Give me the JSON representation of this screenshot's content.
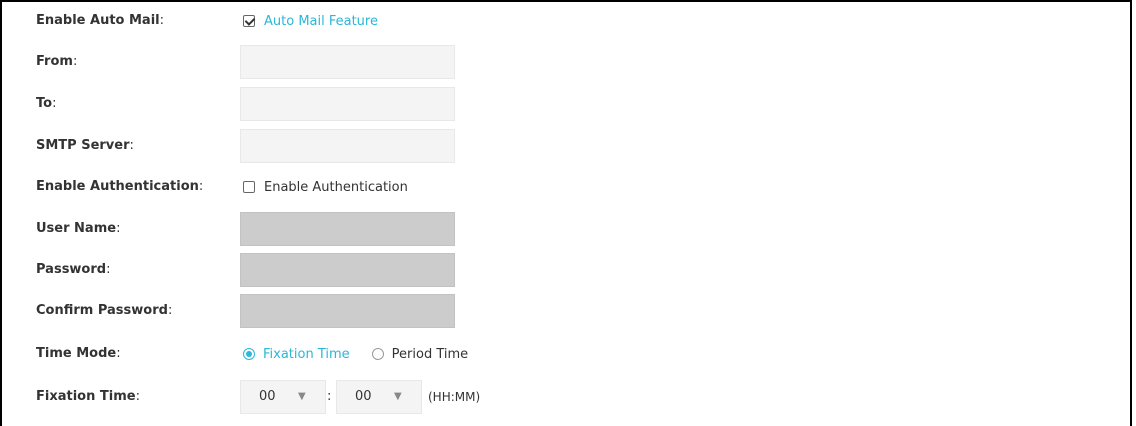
{
  "form": {
    "enable_auto_mail": {
      "label": "Enable Auto Mail",
      "colon": ":",
      "checkbox_label": "Auto Mail Feature",
      "checked": true
    },
    "from": {
      "label": "From",
      "colon": ":",
      "value": ""
    },
    "to": {
      "label": "To",
      "colon": ":",
      "value": ""
    },
    "smtp_server": {
      "label": "SMTP Server",
      "colon": ":",
      "value": ""
    },
    "enable_authentication": {
      "label": "Enable Authentication",
      "colon": ":",
      "checkbox_label": "Enable Authentication",
      "checked": false
    },
    "user_name": {
      "label": "User Name",
      "colon": ":",
      "value": ""
    },
    "password": {
      "label": "Password",
      "colon": ":",
      "value": ""
    },
    "confirm_password": {
      "label": "Confirm Password",
      "colon": ":",
      "value": ""
    },
    "time_mode": {
      "label": "Time Mode",
      "colon": ":",
      "options": [
        "Fixation Time",
        "Period Time"
      ],
      "selected": "Fixation Time"
    },
    "fixation_time": {
      "label": "Fixation Time",
      "colon": ":",
      "hour": "00",
      "minute": "00",
      "separator": ":",
      "format": "(HH:MM)"
    }
  },
  "colors": {
    "accent": "#2bb7d6",
    "input_bg": "#f4f4f4",
    "disabled_bg": "#cccccc"
  },
  "icons": {
    "dropdown": "chevron-down-icon",
    "check": "check-icon"
  }
}
